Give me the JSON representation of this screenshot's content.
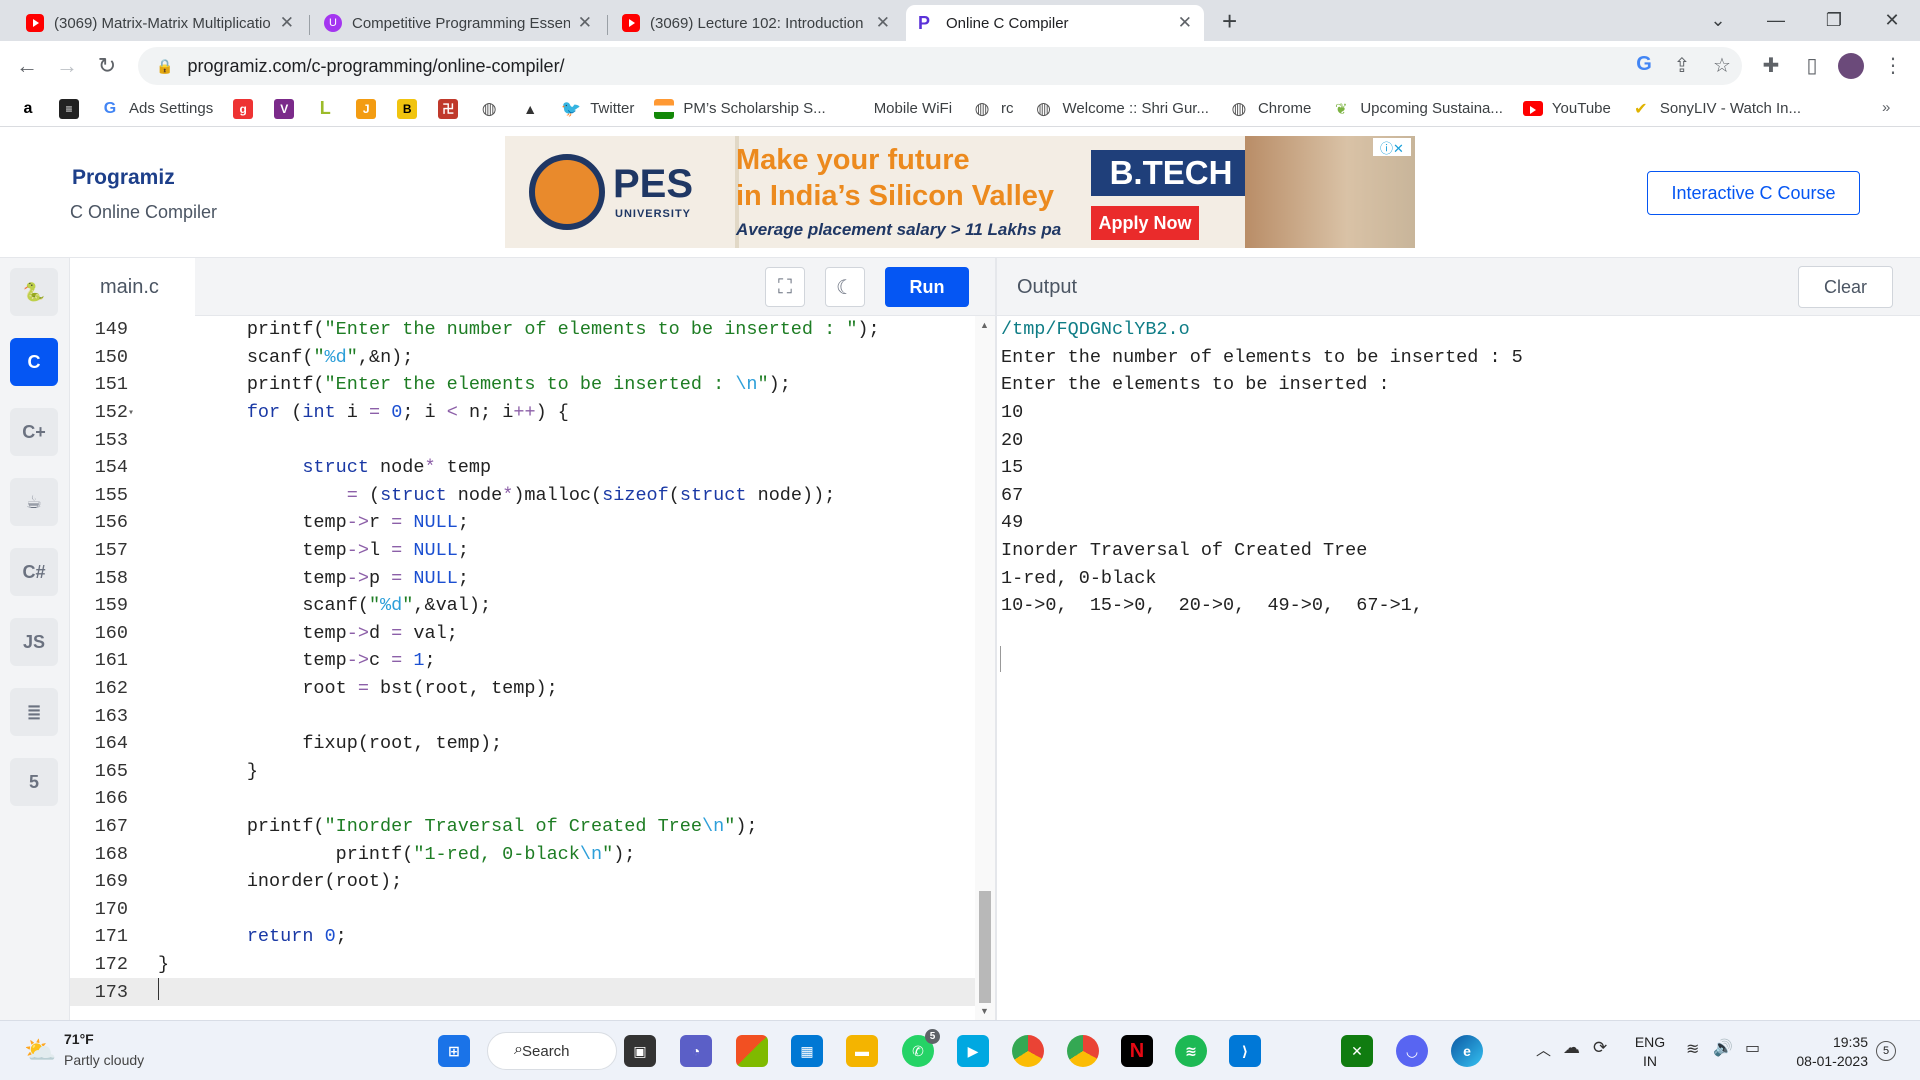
{
  "browser": {
    "tabs": [
      {
        "title": "(3069) Matrix-Matrix Multiplicatio",
        "favicon": "youtube-icon"
      },
      {
        "title": "Competitive Programming Essen",
        "favicon": "udemy-icon"
      },
      {
        "title": "(3069) Lecture 102: Introduction",
        "favicon": "youtube-icon"
      },
      {
        "title": "Online C Compiler",
        "favicon": "programiz-icon"
      }
    ],
    "url": "programiz.com/c-programming/online-compiler/",
    "bookmarks": [
      "Ads Settings",
      "Twitter",
      "PM’s Scholarship S...",
      "Mobile WiFi",
      "rc",
      "Welcome :: Shri Gur...",
      "Chrome",
      "Upcoming Sustaina...",
      "YouTube",
      "SonyLIV - Watch In..."
    ]
  },
  "site": {
    "logo": "Programiz",
    "subtitle": "C Online Compiler",
    "course_button": "Interactive C Course",
    "ad": {
      "brand": "PES",
      "brand_sub": "UNIVERSITY",
      "headline1": "Make your future",
      "headline2": "in India’s Silicon Valley",
      "tagline": "Average placement salary > 11 Lakhs pa",
      "badge": "B.TECH",
      "cta": "Apply Now"
    }
  },
  "editor": {
    "filename": "main.c",
    "run_label": "Run",
    "sidebar_languages": [
      "python",
      "c",
      "cpp",
      "java",
      "csharp",
      "JS",
      "sql",
      "html"
    ],
    "lines": [
      149,
      150,
      151,
      152,
      153,
      154,
      155,
      156,
      157,
      158,
      159,
      160,
      161,
      162,
      163,
      164,
      165,
      166,
      167,
      168,
      169,
      170,
      171,
      172,
      173
    ]
  },
  "output": {
    "label": "Output",
    "clear_label": "Clear",
    "lines": [
      "/tmp/FQDGNclYB2.o",
      "Enter the number of elements to be inserted : 5",
      "Enter the elements to be inserted :",
      "10",
      "20",
      "15",
      "67",
      "49",
      "Inorder Traversal of Created Tree",
      "1-red, 0-black",
      "10->0,  15->0,  20->0,  49->0,  67->1,"
    ]
  },
  "taskbar": {
    "weather_temp": "71°F",
    "weather_desc": "Partly cloudy",
    "search_label": "Search",
    "lang_line1": "ENG",
    "lang_line2": "IN",
    "time": "19:35",
    "date": "08-01-2023",
    "notif_count": "5"
  }
}
